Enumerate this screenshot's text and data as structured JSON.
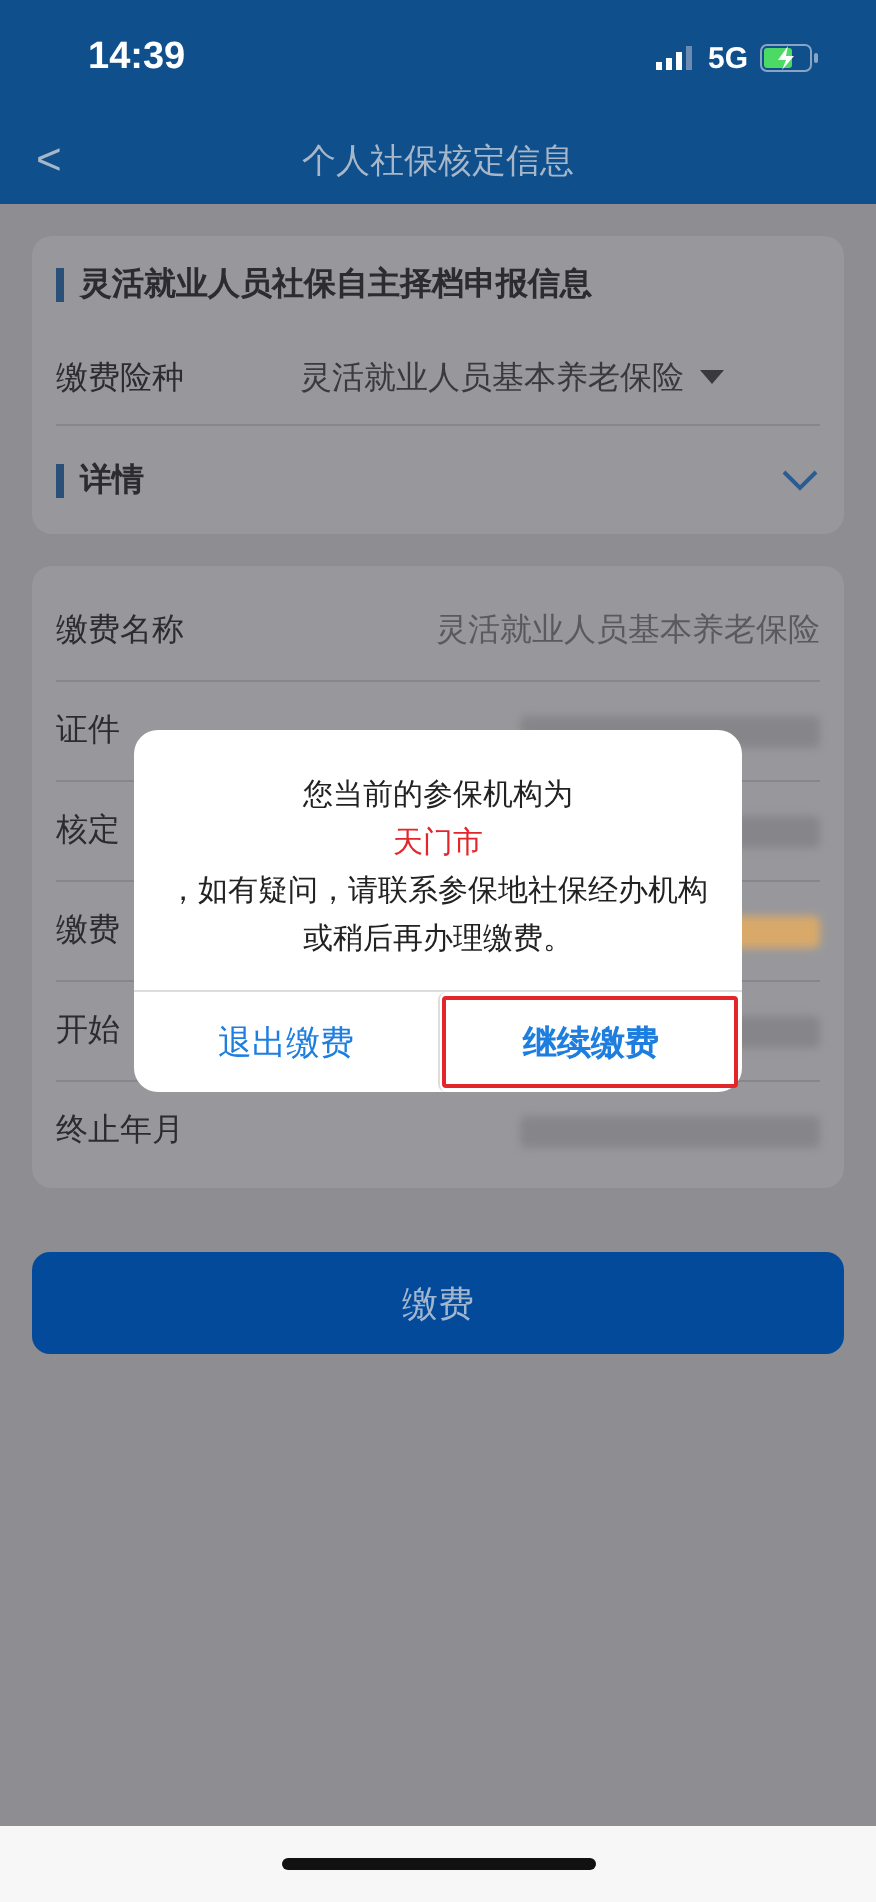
{
  "status_bar": {
    "time": "14:39",
    "network": "5G"
  },
  "nav": {
    "back": "<",
    "title": "个人社保核定信息"
  },
  "section": {
    "title": "灵活就业人员社保自主择档申报信息",
    "field": {
      "label": "缴费险种",
      "value": "灵活就业人员基本养老保险"
    }
  },
  "details": {
    "title": "详情",
    "expanded": false
  },
  "rows": [
    {
      "label": "缴费名称",
      "value": "灵活就业人员基本养老保险"
    },
    {
      "label": "证件",
      "redacted": true
    },
    {
      "label": "核定",
      "redacted": true
    },
    {
      "label": "缴费",
      "redacted": true,
      "color": "#d9a96a"
    },
    {
      "label": "开始",
      "redacted": true
    },
    {
      "label": "终止年月",
      "redacted": true
    }
  ],
  "pay_button": "缴费",
  "dialog": {
    "lines": [
      {
        "text": "您当前的参保机构为",
        "kind": "normal"
      },
      {
        "text": "天门市",
        "kind": "highlight"
      },
      {
        "text": "，如有疑问，请联系参保地社保经办机构或稍后再办理缴费。",
        "kind": "normal"
      }
    ],
    "buttons": [
      {
        "label": "退出缴费",
        "primary": false,
        "highlighted": false
      },
      {
        "label": "继续缴费",
        "primary": true,
        "highlighted": true
      }
    ]
  }
}
